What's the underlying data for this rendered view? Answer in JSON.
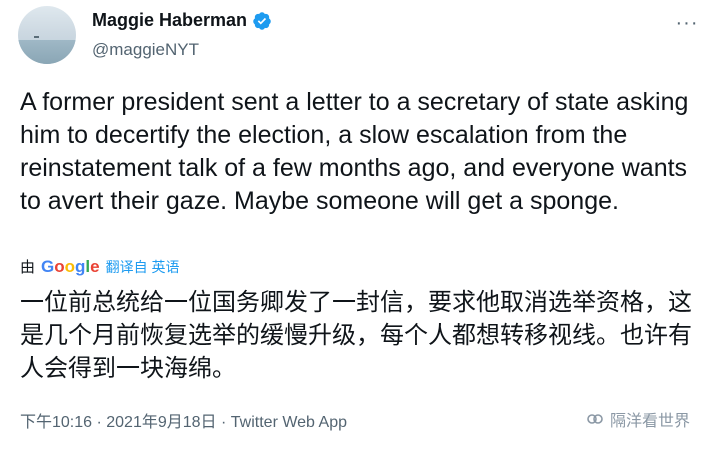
{
  "author": {
    "display_name": "Maggie Haberman",
    "handle": "@maggieNYT"
  },
  "tweet": {
    "text": "A former president sent a letter to a secretary of state asking him to decertify the election, a slow escalation from the reinstatement talk of a few months ago, and everyone wants to avert their gaze. Maybe someone will get a sponge.",
    "translation_prefix": "由",
    "translation_provider": "Google",
    "translation_link": "翻译自 英语",
    "translated_text": "一位前总统给一位国务卿发了一封信，要求他取消选举资格，这是几个月前恢复选举的缓慢升级，每个人都想转移视线。也许有人会得到一块海绵。",
    "timestamp": "下午10:16 · 2021年9月18日",
    "separator": " · ",
    "source": "Twitter Web App"
  },
  "more_menu": "···",
  "watermark": {
    "text": "隔洋看世界"
  },
  "colors": {
    "text_primary": "#0f1419",
    "text_secondary": "#536471",
    "link": "#1d9bf0",
    "verified": "#1d9bf0"
  },
  "icons": {
    "verified": "verified-badge-icon",
    "more": "more-horizontal-icon",
    "watermark_logo": "wechat-channel-icon"
  }
}
